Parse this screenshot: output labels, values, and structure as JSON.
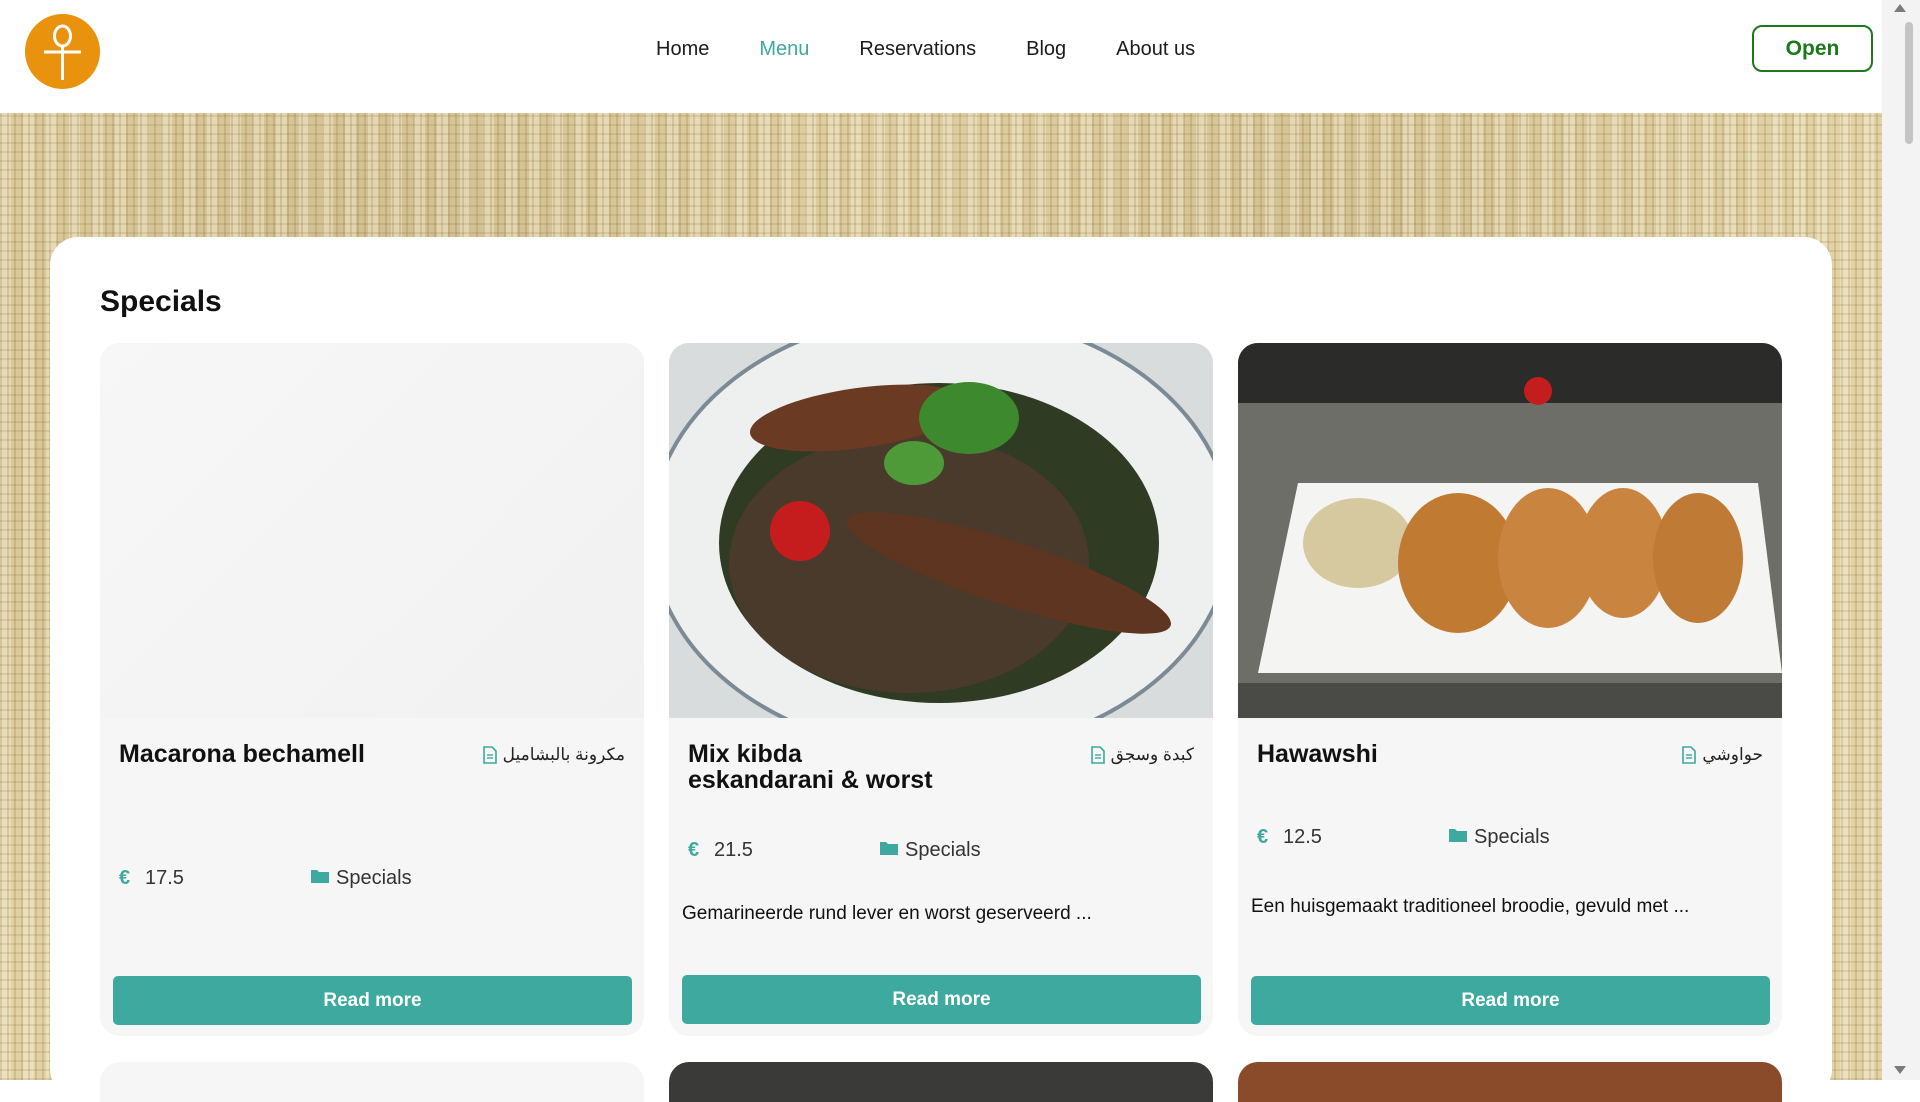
{
  "header": {
    "nav": [
      {
        "label": "Home",
        "active": false
      },
      {
        "label": "Menu",
        "active": true
      },
      {
        "label": "Reservations",
        "active": false
      },
      {
        "label": "Blog",
        "active": false
      },
      {
        "label": "About us",
        "active": false
      }
    ],
    "open_label": "Open"
  },
  "section": {
    "title": "Specials"
  },
  "cards": [
    {
      "name": "Macarona bechamell",
      "arabic": "مكرونة بالبشاميل",
      "currency": "€",
      "price": "17.5",
      "category": "Specials",
      "description": "",
      "button": "Read more"
    },
    {
      "name_line1": "Mix kibda",
      "name_line2": "eskandarani & worst",
      "arabic": "كبدة وسجق",
      "currency": "€",
      "price": "21.5",
      "category": "Specials",
      "description": "Gemarineerde rund lever en worst geserveerd ...",
      "button": "Read more"
    },
    {
      "name": "Hawawshi",
      "arabic": "حواوشي",
      "currency": "€",
      "price": "12.5",
      "category": "Specials",
      "description": "Een huisgemaakt traditioneel broodie, gevuld met ...",
      "button": "Read more"
    }
  ],
  "colors": {
    "accent": "#3ea99f",
    "open_border": "#1a7a1a",
    "logo": "#e9920e"
  }
}
